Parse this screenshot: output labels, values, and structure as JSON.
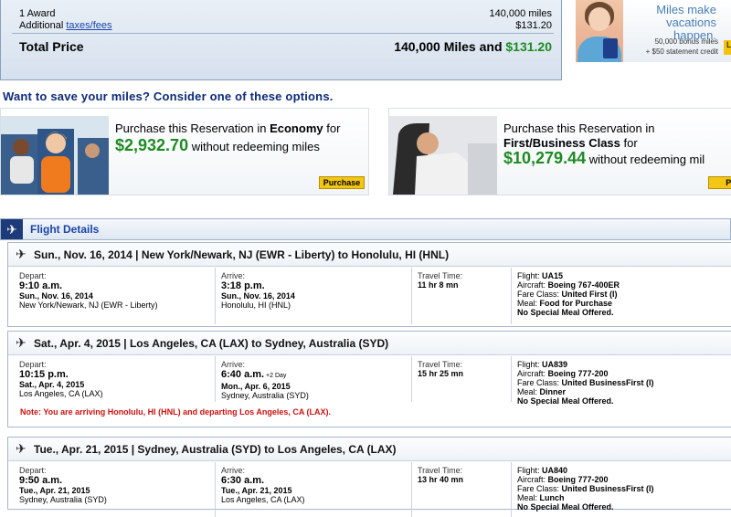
{
  "summary": {
    "award_label": "1 Award",
    "award_miles": "140,000 miles",
    "additional_prefix": "Additional ",
    "taxes_link": "taxes/fees",
    "taxes_amount": "$131.20",
    "total_label": "Total Price",
    "total_miles": "140,000 Miles and ",
    "total_cash": "$131.20"
  },
  "ad": {
    "headline_1": "Miles make",
    "headline_2": "vacations happen.",
    "bonus": "50,000 bonus miles",
    "credit": "+ $50 statement credit",
    "cta": "L"
  },
  "promo_heading": "Want to save your miles? Consider one of these options.",
  "promos": [
    {
      "prefix": "Purchase this Reservation in ",
      "cabin": "Economy",
      "suffix": " for",
      "price": "$2,932.70",
      "tail": " without redeeming miles",
      "button": "Purchase"
    },
    {
      "prefix": "Purchase this Reservation in",
      "cabin": "First/Business Class",
      "suffix": " for",
      "price": "$10,279.44",
      "tail": " without redeeming mil",
      "button": "Pu"
    }
  ],
  "flight_details": {
    "title": "Flight Details",
    "depart_label": "Depart:",
    "arrive_label": "Arrive:",
    "travel_label": "Travel Time:",
    "flights": [
      {
        "route": "Sun., Nov. 16, 2014 | New York/Newark, NJ (EWR - Liberty) to Honolulu, HI (HNL)",
        "depart_time": "9:10 a.m.",
        "depart_date": "Sun., Nov. 16, 2014",
        "depart_place": "New York/Newark, NJ (EWR - Liberty)",
        "arrive_time": "3:18 p.m.",
        "arrive_extra": "",
        "arrive_date": "Sun., Nov. 16, 2014",
        "arrive_place": "Honolulu, HI (HNL)",
        "travel_time": "11 hr 8 mn",
        "flight_prefix": "Flight: ",
        "flight": "UA15",
        "aircraft_prefix": "Aircraft: ",
        "aircraft": "Boeing 767-400ER",
        "fare_prefix": "Fare Class: ",
        "fare": "United First (I)",
        "meal_prefix": "Meal: ",
        "meal": "Food for Purchase",
        "special_meal": "No Special Meal Offered."
      },
      {
        "route": "Sat., Apr. 4, 2015 | Los Angeles, CA (LAX) to Sydney, Australia (SYD)",
        "depart_time": "10:15 p.m.",
        "depart_date": "Sat., Apr. 4, 2015",
        "depart_place": "Los Angeles, CA (LAX)",
        "arrive_time": "6:40 a.m.",
        "arrive_extra": " +2 Day",
        "arrive_date": "Mon., Apr. 6, 2015",
        "arrive_place": "Sydney, Australia (SYD)",
        "travel_time": "15 hr 25 mn",
        "flight_prefix": "Flight: ",
        "flight": "UA839",
        "aircraft_prefix": "Aircraft: ",
        "aircraft": "Boeing 777-200",
        "fare_prefix": "Fare Class: ",
        "fare": "United BusinessFirst (I)",
        "meal_prefix": "Meal: ",
        "meal": "Dinner",
        "special_meal": "No Special Meal Offered."
      },
      {
        "route": "Tue., Apr. 21, 2015 | Sydney, Australia (SYD) to Los Angeles, CA (LAX)",
        "depart_time": "9:50 a.m.",
        "depart_date": "Tue., Apr. 21, 2015",
        "depart_place": "Sydney, Australia (SYD)",
        "arrive_time": "6:30 a.m.",
        "arrive_extra": "",
        "arrive_date": "Tue., Apr. 21, 2015",
        "arrive_place": "Los Angeles, CA (LAX)",
        "travel_time": "13 hr 40 mn",
        "flight_prefix": "Flight: ",
        "flight": "UA840",
        "aircraft_prefix": "Aircraft: ",
        "aircraft": "Boeing 777-200",
        "fare_prefix": "Fare Class: ",
        "fare": "United BusinessFirst (I)",
        "meal_prefix": "Meal: ",
        "meal": "Lunch",
        "special_meal": "No Special Meal Offered."
      }
    ],
    "note": "Note: You are arriving Honolulu, HI (HNL) and departing Los Angeles, CA (LAX)."
  },
  "colors": {
    "accent_blue": "#1a44a8",
    "heading_navy": "#0d2a7a",
    "price_green": "#1e8b22",
    "note_red": "#cc1111",
    "button_yellow": "#f3c614"
  }
}
